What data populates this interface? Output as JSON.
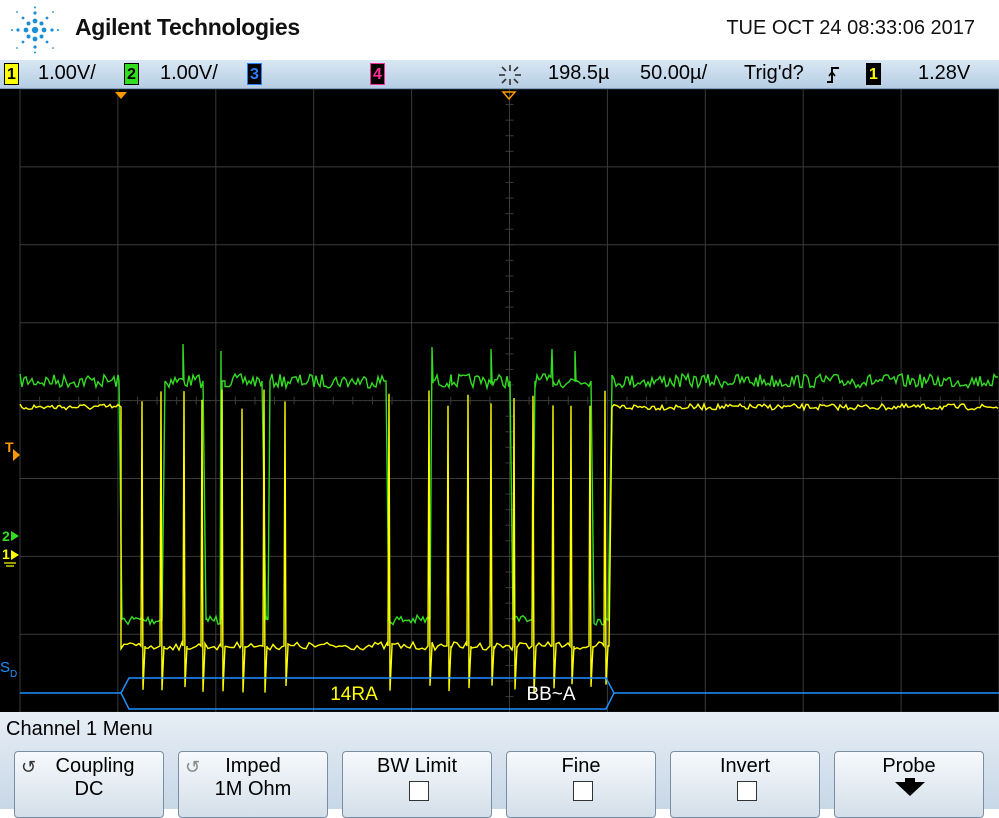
{
  "header": {
    "brand": "Agilent Technologies",
    "datetime": "TUE OCT 24 08:33:06 2017"
  },
  "status_bar": {
    "ch1": {
      "num": "1",
      "scale": "1.00V/",
      "color": "#ffff00"
    },
    "ch2": {
      "num": "2",
      "scale": "1.00V/",
      "color": "#33dd22"
    },
    "ch3": {
      "num": "3",
      "color": "#2a7fff"
    },
    "ch4": {
      "num": "4",
      "color": "#ff2d9a"
    },
    "delay": "198.5µ",
    "timebase": "50.00µ/",
    "trigger_state": "Trig'd?",
    "trigger_edge_icon": "rising-edge-icon",
    "trigger_source": "1",
    "trigger_level": "1.28V"
  },
  "screen": {
    "trigger_marker": "T",
    "ch2_marker": "2",
    "ch1_marker": "1",
    "serial_marker": "S",
    "serial_marker_sub": "D",
    "decode": [
      "14RA",
      "BB~A"
    ],
    "colors": {
      "grid": "#3a3a3a",
      "ch1": "#ffff00",
      "ch2": "#33dd22",
      "bus": "#1e90ff",
      "marker": "#ff9900"
    }
  },
  "menu": {
    "title": "Channel 1  Menu",
    "softkeys": [
      {
        "line1": "Coupling",
        "line2": "DC",
        "icon": "rotate-select-icon"
      },
      {
        "line1": "Imped",
        "line2": "1M Ohm",
        "icon": "rotate-select-icon"
      },
      {
        "line1": "BW Limit",
        "checked": false
      },
      {
        "line1": "Fine",
        "checked": false
      },
      {
        "line1": "Invert",
        "checked": false
      },
      {
        "line1": "Probe",
        "icon": "down-arrow-icon"
      }
    ]
  }
}
